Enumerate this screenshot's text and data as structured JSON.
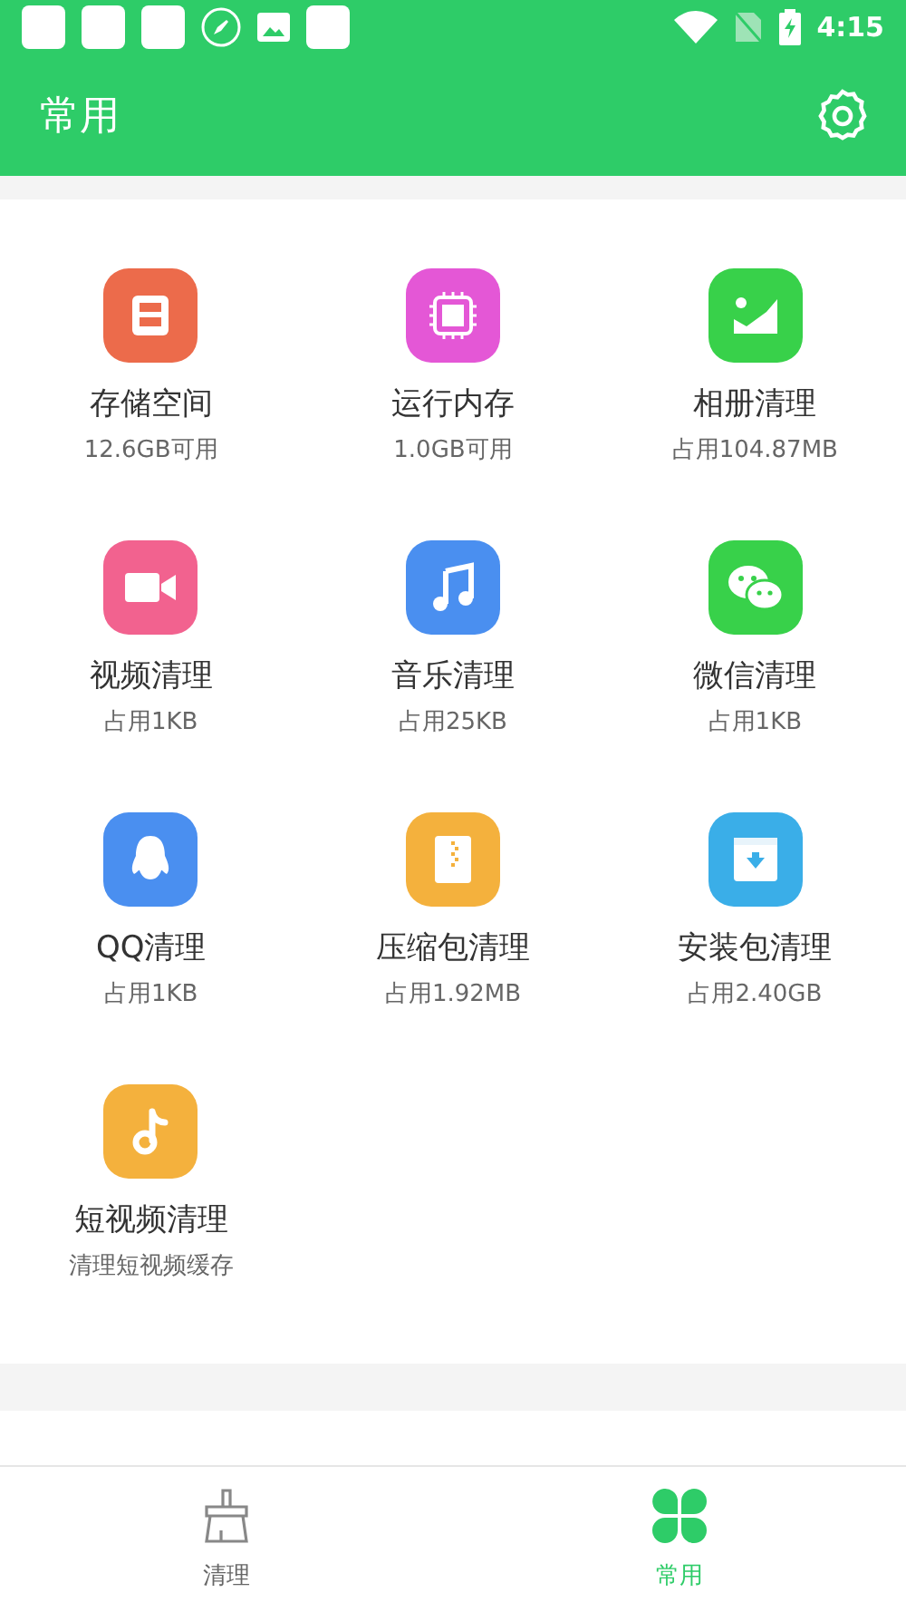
{
  "status_bar": {
    "time": "4:15"
  },
  "app_bar": {
    "title": "常用"
  },
  "tools": [
    {
      "kind": "storage",
      "color": "#ec6b4b",
      "title": "存储空间",
      "subtitle": "12.6GB可用"
    },
    {
      "kind": "chip",
      "color": "#e457d6",
      "title": "运行内存",
      "subtitle": "1.0GB可用"
    },
    {
      "kind": "photo",
      "color": "#38d14a",
      "title": "相册清理",
      "subtitle": "占用104.87MB"
    },
    {
      "kind": "video",
      "color": "#f2628f",
      "title": "视频清理",
      "subtitle": "占用1KB"
    },
    {
      "kind": "music",
      "color": "#4a8ff0",
      "title": "音乐清理",
      "subtitle": "占用25KB"
    },
    {
      "kind": "chat",
      "color": "#38d14a",
      "title": "微信清理",
      "subtitle": "占用1KB"
    },
    {
      "kind": "penguin",
      "color": "#4a8ff0",
      "title": "QQ清理",
      "subtitle": "占用1KB"
    },
    {
      "kind": "zip",
      "color": "#f4b13d",
      "title": "压缩包清理",
      "subtitle": "占用1.92MB"
    },
    {
      "kind": "package",
      "color": "#3aaee8",
      "title": "安装包清理",
      "subtitle": "占用2.40GB"
    },
    {
      "kind": "note",
      "color": "#f4b13d",
      "title": "短视频清理",
      "subtitle": "清理短视频缓存"
    }
  ],
  "bottom_nav": [
    {
      "kind": "broom",
      "label": "清理",
      "selected": false
    },
    {
      "kind": "clover",
      "label": "常用",
      "selected": true
    }
  ]
}
